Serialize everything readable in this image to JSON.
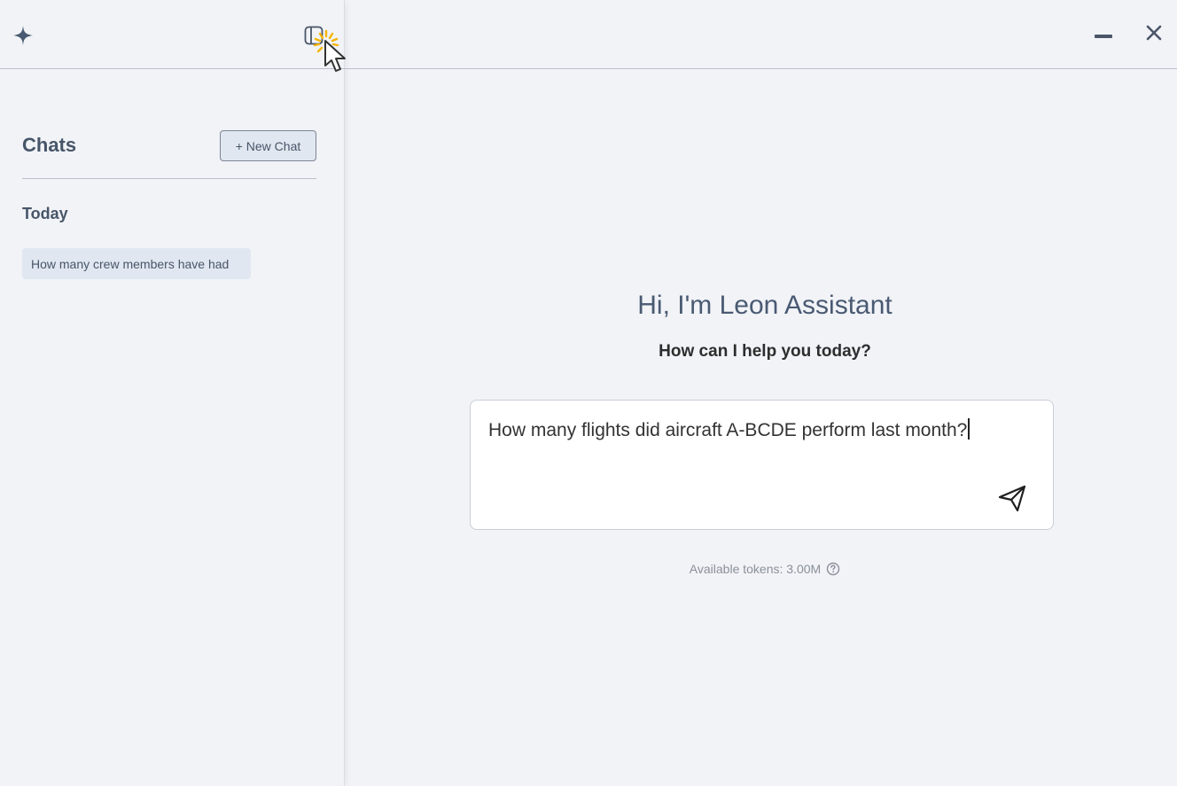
{
  "sidebar": {
    "title": "Chats",
    "new_chat_label": "+ New Chat",
    "section_today": "Today",
    "chats": [
      {
        "label": "How many crew members have had"
      }
    ]
  },
  "main": {
    "greeting": "Hi, I'm Leon Assistant",
    "subgreeting": "How can I help you today?",
    "input_value": "How many flights did aircraft A-BCDE perform last month?",
    "tokens_label": "Available tokens: 3.00M"
  },
  "icons": {
    "logo": "sparkle-icon",
    "sidebar_toggle": "sidebar-toggle-icon",
    "minimize": "minimize-icon",
    "close": "close-icon",
    "send": "send-icon",
    "help": "help-circle-icon"
  },
  "colors": {
    "background": "#f1f3f7",
    "text": "#475569",
    "chip": "#e1e7f0",
    "click_highlight": "#f5b400"
  }
}
